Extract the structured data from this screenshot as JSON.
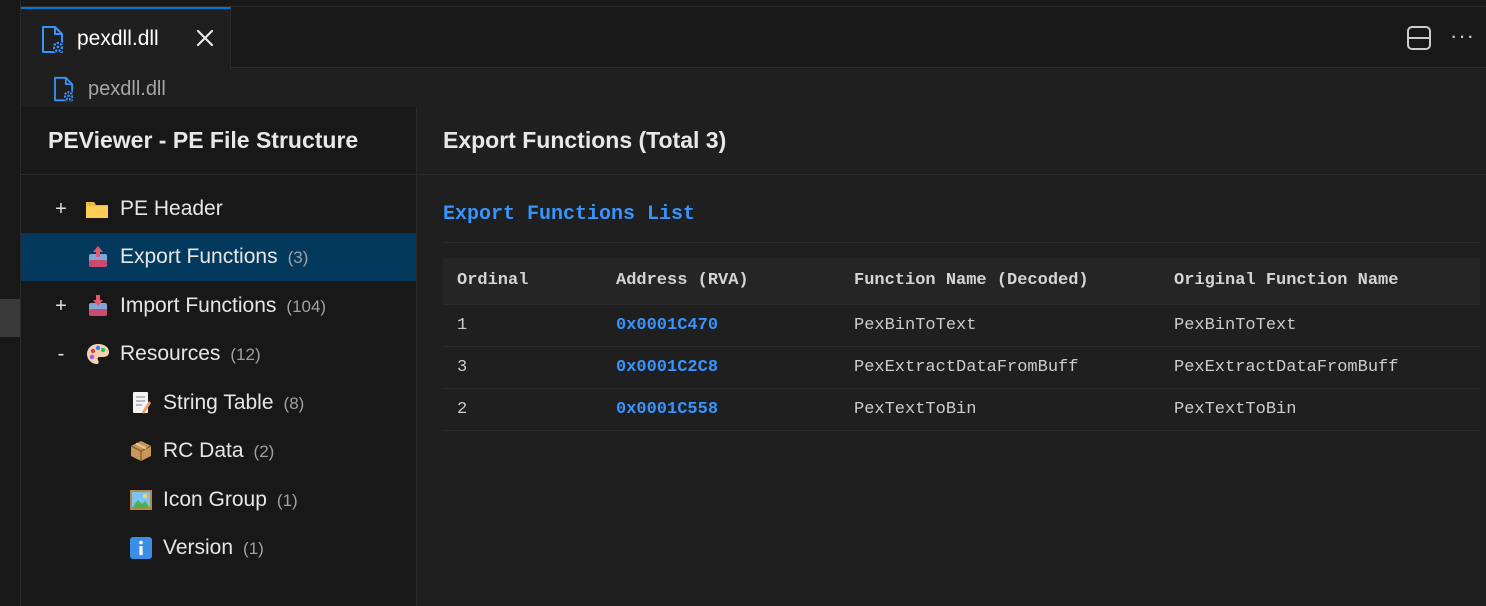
{
  "tab": {
    "label": "pexdll.dll",
    "close_icon": "close-icon"
  },
  "editor_actions": {
    "split_icon": "split-editor-icon",
    "more_label": "···"
  },
  "breadcrumb": {
    "label": "pexdll.dll"
  },
  "tree": {
    "title": "PEViewer - PE File Structure",
    "items": [
      {
        "toggle": "+",
        "icon": "folder-icon",
        "label": "PE Header",
        "count": ""
      },
      {
        "toggle": "",
        "icon": "export-box-icon",
        "label": "Export Functions",
        "count": "(3)"
      },
      {
        "toggle": "+",
        "icon": "import-box-icon",
        "label": "Import Functions",
        "count": "(104)"
      },
      {
        "toggle": "-",
        "icon": "palette-icon",
        "label": "Resources",
        "count": "(12)"
      },
      {
        "toggle": "",
        "icon": "memo-icon",
        "label": "String Table",
        "count": "(8)"
      },
      {
        "toggle": "",
        "icon": "package-icon",
        "label": "RC Data",
        "count": "(2)"
      },
      {
        "toggle": "",
        "icon": "picture-icon",
        "label": "Icon Group",
        "count": "(1)"
      },
      {
        "toggle": "",
        "icon": "info-icon",
        "label": "Version",
        "count": "(1)"
      }
    ]
  },
  "main": {
    "title": "Export Functions (Total 3)",
    "section_title": "Export Functions List",
    "table": {
      "headers": [
        "Ordinal",
        "Address (RVA)",
        "Function Name (Decoded)",
        "Original Function Name"
      ],
      "rows": [
        [
          "1",
          "0x0001C470",
          "PexBinToText",
          "PexBinToText"
        ],
        [
          "3",
          "0x0001C2C8",
          "PexExtractDataFromBuff",
          "PexExtractDataFromBuff"
        ],
        [
          "2",
          "0x0001C558",
          "PexTextToBin",
          "PexTextToBin"
        ]
      ]
    }
  },
  "colors": {
    "accent": "#0078d4",
    "selection": "#04395e",
    "link": "#3794ff",
    "background": "#1f1f1f"
  }
}
